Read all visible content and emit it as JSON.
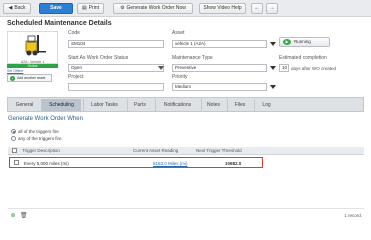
{
  "toolbar": {
    "back": "Back",
    "save": "Save",
    "print": "Print",
    "generate": "Generate Work Order Now",
    "help": "Show Video Help"
  },
  "page": {
    "title": "Scheduled Maintenance Details"
  },
  "asset_card": {
    "name": "A2A - vehicle 1",
    "status": "Online",
    "set_offline": "Set Offline",
    "add_asset": "Add another asset"
  },
  "form": {
    "code_label": "Code",
    "code_value": "SM104",
    "asset_label": "Asset",
    "asset_value": "vehicle 1 (A2A)",
    "status_label": "Start As Work Order Status",
    "status_value": "Open",
    "maint_type_label": "Maintenance Type",
    "maint_type_value": "Preventive",
    "est_label": "Estimated completion",
    "est_days": "10",
    "est_suffix": "days after WO created",
    "project_label": "Project",
    "project_value": "",
    "priority_label": "Priority",
    "priority_value": "Medium",
    "flow_button": "Running"
  },
  "tabs": [
    "General",
    "Scheduling",
    "Labor Tasks",
    "Parts",
    "Notifications",
    "Notes",
    "Files",
    "Log"
  ],
  "active_tab": "Scheduling",
  "scheduling": {
    "title": "Generate Work Order When",
    "option_all": "all of the triggers fire",
    "option_any": "any of the triggers fire",
    "columns": [
      "Trigger Description",
      "Current Asset Reading",
      "Next Trigger Threshold"
    ],
    "rows": [
      {
        "description": "Every 5,000 miles (mi)",
        "current": "8183.0 Miles (mi)",
        "next": "10682.0"
      }
    ],
    "records": "1 record."
  },
  "icons": [
    "back-icon",
    "save-icon",
    "print-icon",
    "gear-icon",
    "help-icon",
    "arrow-left-icon",
    "arrow-right-icon",
    "forklift-icon",
    "play-icon",
    "add-icon",
    "delete-icon"
  ],
  "colors": {
    "accent": "#2d7fd3",
    "online": "#2ba346",
    "highlight": "#e03a2f",
    "link": "#2d6db5"
  }
}
